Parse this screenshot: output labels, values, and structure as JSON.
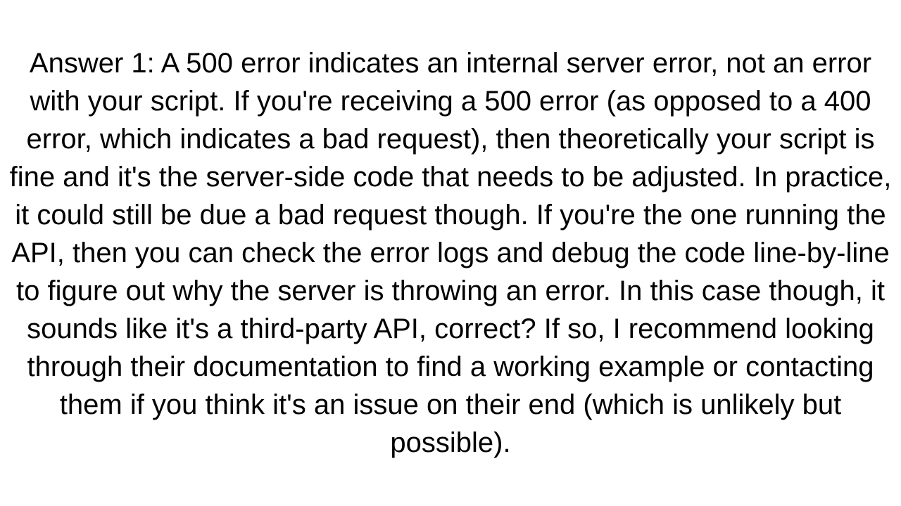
{
  "answer": {
    "label": "Answer 1:",
    "body": "A 500 error indicates an internal server error, not an error with your script. If you're receiving a 500 error (as opposed to a 400 error, which indicates a bad request), then theoretically your script is fine and it's the server-side code that needs to be adjusted. In practice, it could still be due a bad request though. If you're the one running the API, then you can check the error logs and debug the code line-by-line to figure out why the server is throwing an error. In this case though, it sounds like it's a third-party API, correct? If so, I recommend looking through their documentation to find a working example or contacting them if you think it's an issue on their end (which is unlikely but possible)."
  }
}
